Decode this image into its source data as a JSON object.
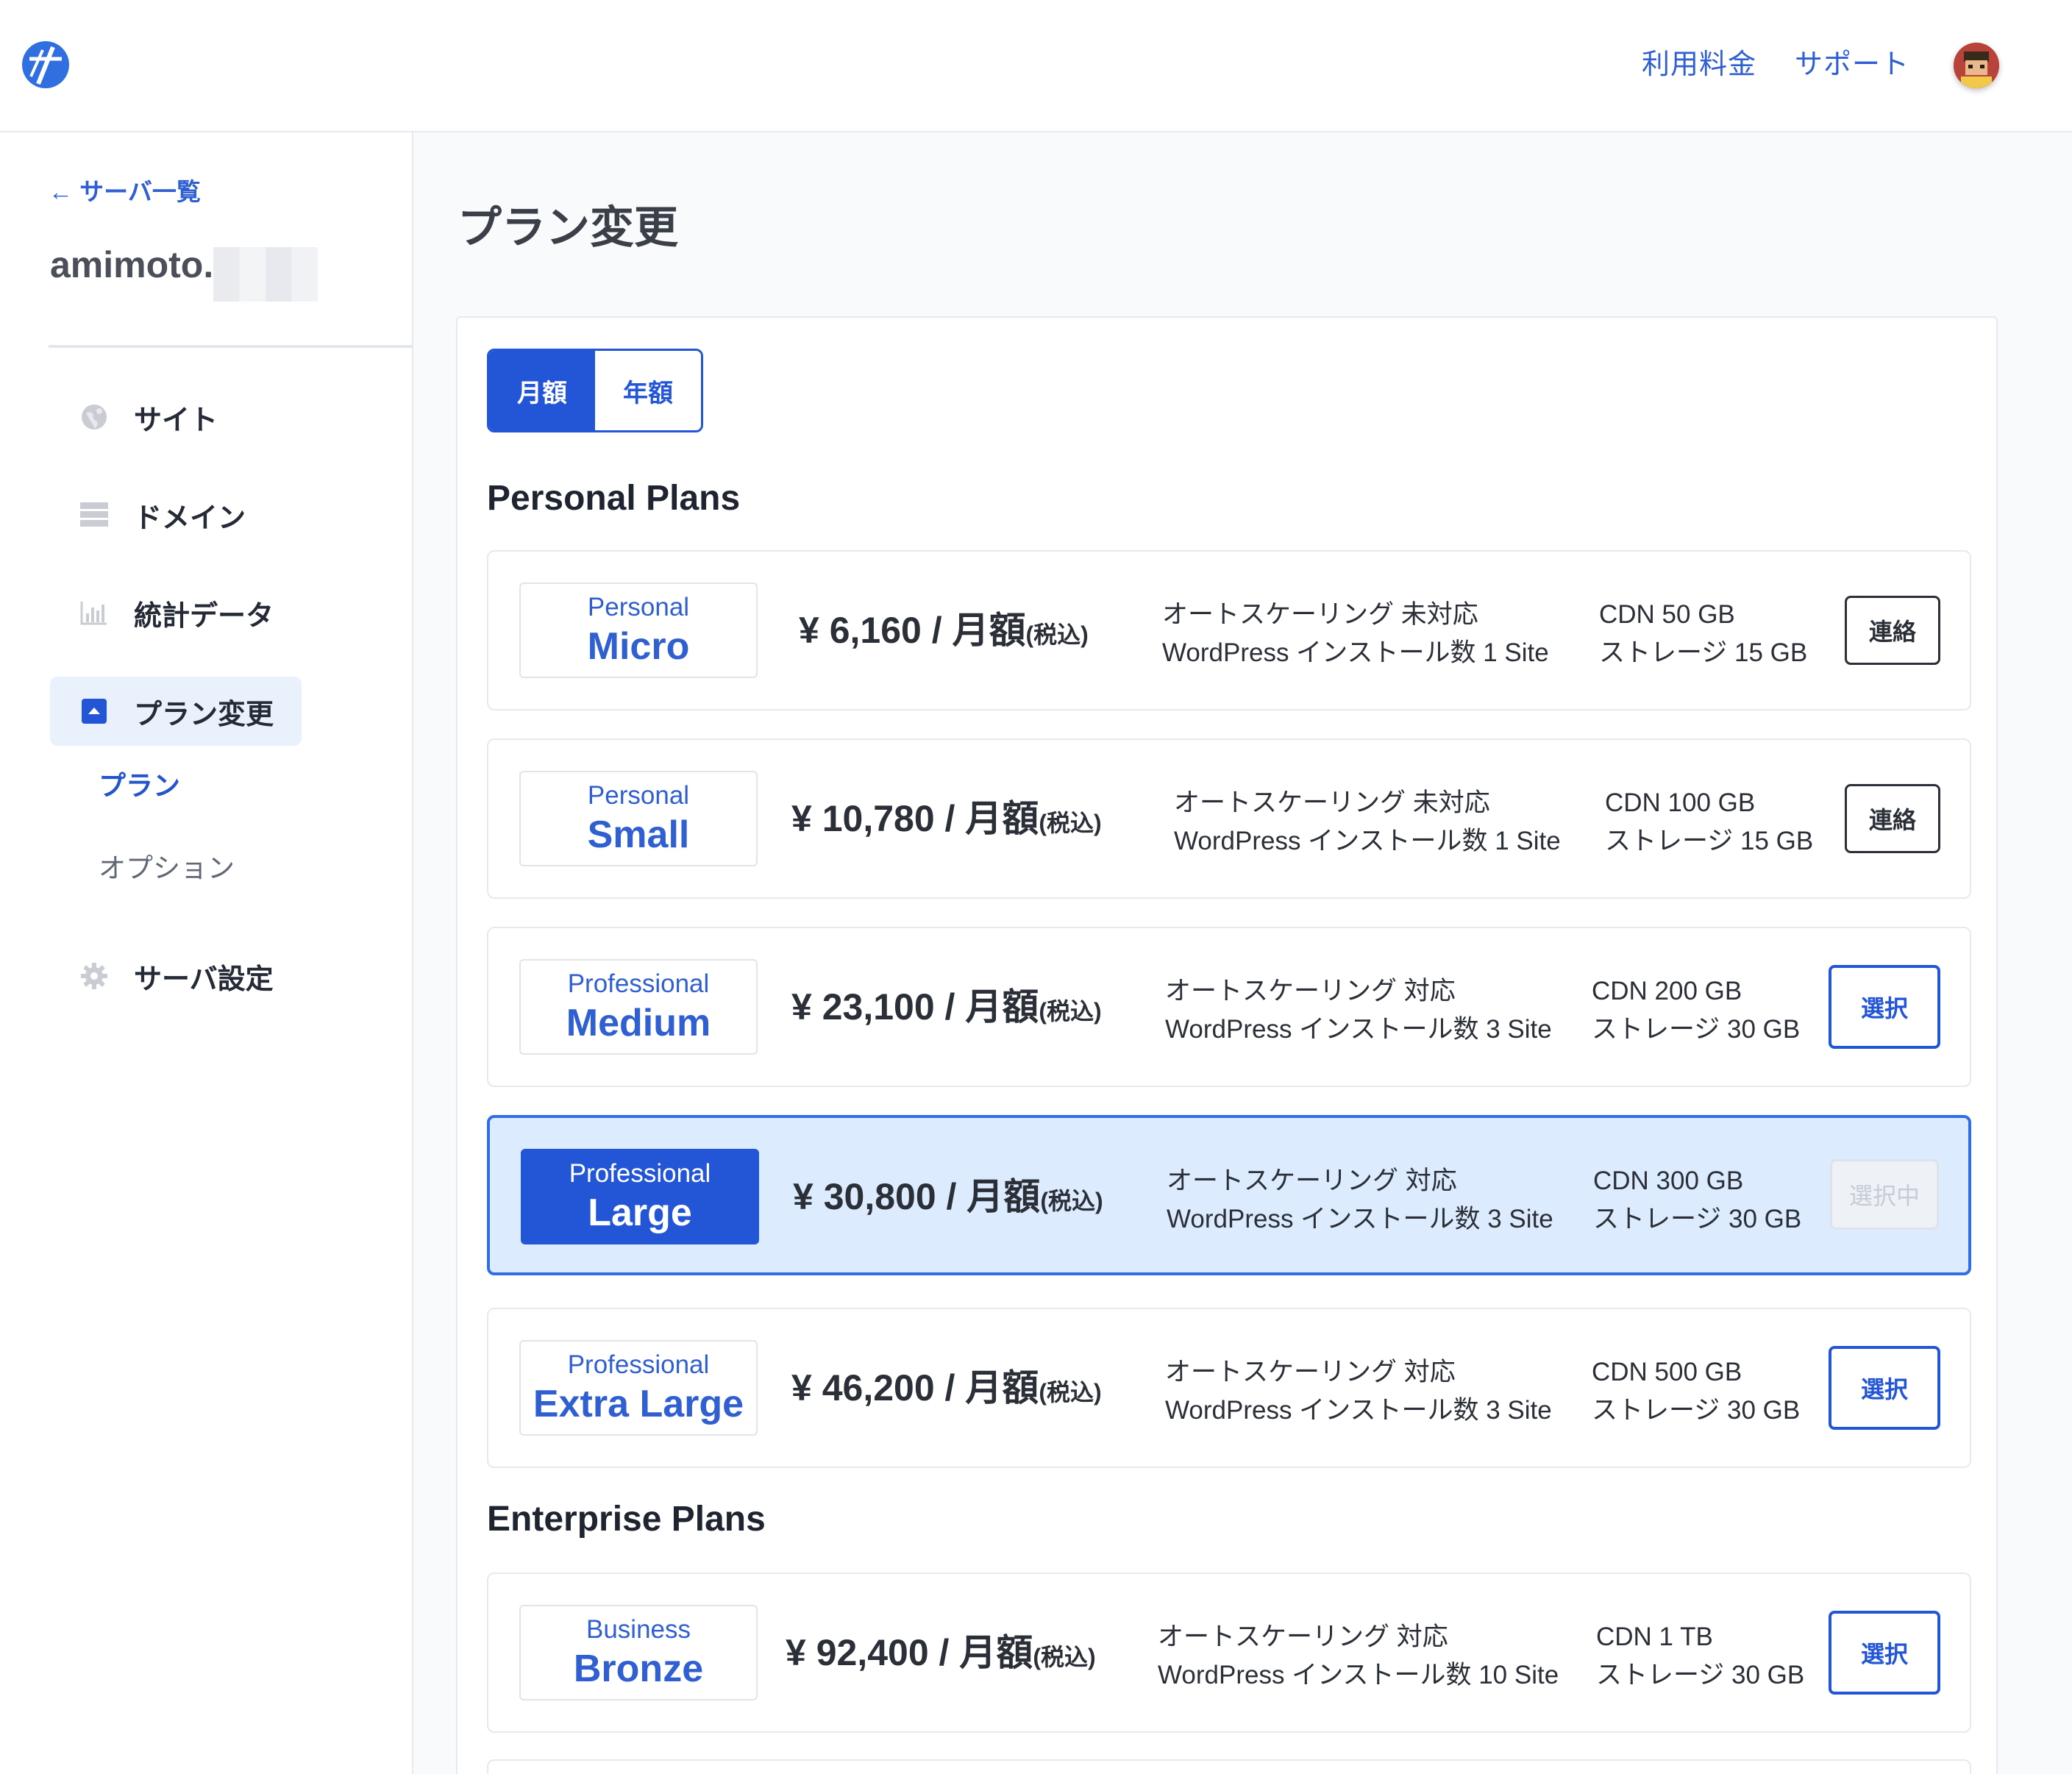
{
  "header": {
    "links": [
      "利用料金",
      "サポート"
    ],
    "avatar_icon": "user-avatar-icon"
  },
  "sidebar": {
    "back_link": "← サーバ一覧",
    "server_name": "amimoto.",
    "nav": [
      {
        "label": "サイト",
        "icon": "globe-icon"
      },
      {
        "label": "ドメイン",
        "icon": "server-list-icon"
      },
      {
        "label": "統計データ",
        "icon": "bar-chart-icon"
      },
      {
        "label": "プラン変更",
        "icon": "upload-box-icon"
      },
      {
        "label": "サーバ設定",
        "icon": "gear-icon"
      }
    ],
    "sub_items": [
      "プラン",
      "オプション"
    ]
  },
  "main": {
    "title": "プラン変更",
    "billing_toggle": [
      "月額",
      "年額"
    ],
    "sections": [
      "Personal Plans",
      "Enterprise Plans"
    ],
    "plans": [
      {
        "tier": "Personal",
        "name": "Micro",
        "price": "¥ 6,160 / 月額",
        "tax": "(税込)",
        "feature1": "オートスケーリング 未対応",
        "feature2": "WordPress インストール数 1 Site",
        "cdn": "CDN 50 GB",
        "storage": "ストレージ 15 GB",
        "action": "連絡"
      },
      {
        "tier": "Personal",
        "name": "Small",
        "price": "¥ 10,780 / 月額",
        "tax": "(税込)",
        "feature1": "オートスケーリング 未対応",
        "feature2": "WordPress インストール数 1 Site",
        "cdn": "CDN 100 GB",
        "storage": "ストレージ 15 GB",
        "action": "連絡"
      },
      {
        "tier": "Professional",
        "name": "Medium",
        "price": "¥ 23,100 / 月額",
        "tax": "(税込)",
        "feature1": "オートスケーリング 対応",
        "feature2": "WordPress インストール数 3 Site",
        "cdn": "CDN 200 GB",
        "storage": "ストレージ 30 GB",
        "action": "選択"
      },
      {
        "tier": "Professional",
        "name": "Large",
        "price": "¥ 30,800 / 月額",
        "tax": "(税込)",
        "feature1": "オートスケーリング 対応",
        "feature2": "WordPress インストール数 3 Site",
        "cdn": "CDN 300 GB",
        "storage": "ストレージ 30 GB",
        "action": "選択中"
      },
      {
        "tier": "Professional",
        "name": "Extra Large",
        "price": "¥ 46,200 / 月額",
        "tax": "(税込)",
        "feature1": "オートスケーリング 対応",
        "feature2": "WordPress インストール数 3 Site",
        "cdn": "CDN 500 GB",
        "storage": "ストレージ 30 GB",
        "action": "選択"
      },
      {
        "tier": "Business",
        "name": "Bronze",
        "price": "¥ 92,400 / 月額",
        "tax": "(税込)",
        "feature1": "オートスケーリング 対応",
        "feature2": "WordPress インストール数 10 Site",
        "cdn": "CDN 1 TB",
        "storage": "ストレージ 30 GB",
        "action": "選択"
      }
    ]
  },
  "colors": {
    "accent": "#2356d6",
    "link": "#2f5fd0",
    "current_bg": "#dcebfd"
  }
}
